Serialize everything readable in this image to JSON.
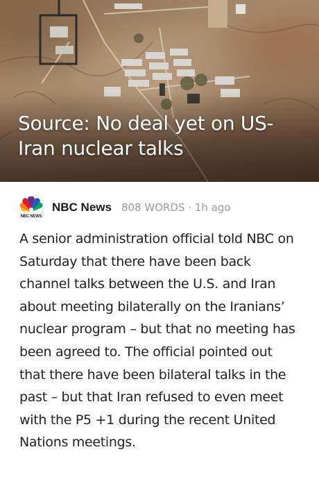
{
  "article": {
    "headline": "Source: No deal yet on US-Iran nuclear talks",
    "source": {
      "logo_icon": "nbc-peacock-icon",
      "logo_text": "NBC NEWS",
      "name": "NBC News",
      "word_count": "808 WORDS",
      "separator": "·",
      "time_ago": "1h ago"
    },
    "body": "A senior administration official told NBC on Saturday that there have been back channel talks between the U.S. and Iran about meeting bilaterally on the Iranians’ nuclear program – but that no meeting has been agreed to. The official pointed out that there have been bilateral talks in the past – but that Iran refused to even meet with the P5 +1 during the recent United Nations meetings."
  },
  "colors": {
    "headline_text": "#ffffff",
    "body_text": "#222222",
    "meta_text": "#9b9b9b",
    "background": "#ffffff"
  }
}
